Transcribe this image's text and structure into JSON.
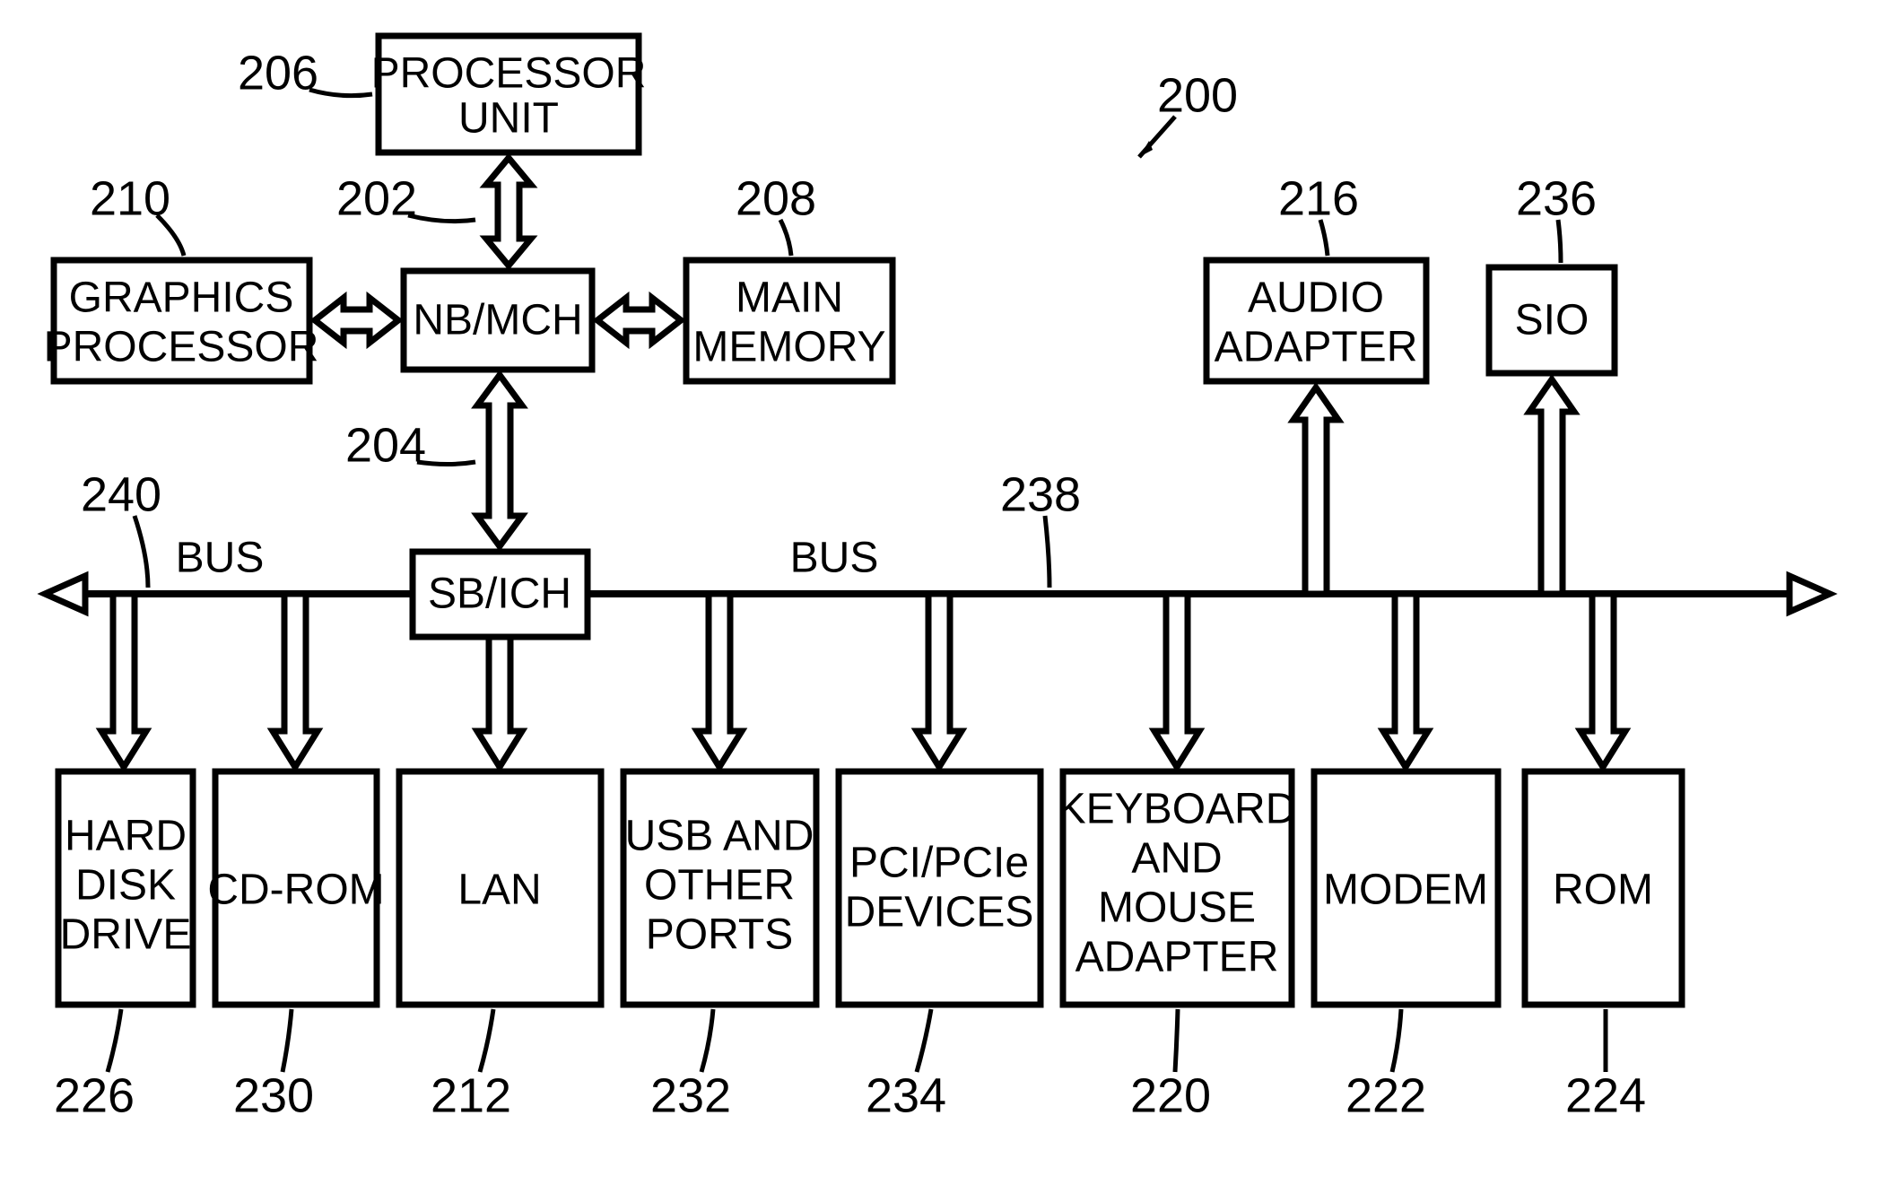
{
  "title_ref": "200",
  "bus_left": {
    "label": "BUS",
    "ref": "240"
  },
  "bus_right": {
    "label": "BUS",
    "ref": "238"
  },
  "boxes": {
    "processor": {
      "label_lines": [
        "PROCESSOR",
        "UNIT"
      ],
      "ref": "206"
    },
    "nbmch": {
      "label_lines": [
        "NB/MCH"
      ],
      "ref": "202"
    },
    "graphics": {
      "label_lines": [
        "GRAPHICS",
        "PROCESSOR"
      ],
      "ref": "210"
    },
    "mainmem": {
      "label_lines": [
        "MAIN",
        "MEMORY"
      ],
      "ref": "208"
    },
    "sbich": {
      "label_lines": [
        "SB/ICH"
      ],
      "ref": "204"
    },
    "audio": {
      "label_lines": [
        "AUDIO",
        "ADAPTER"
      ],
      "ref": "216"
    },
    "sio": {
      "label_lines": [
        "SIO"
      ],
      "ref": "236"
    },
    "hdd": {
      "label_lines": [
        "HARD",
        "DISK",
        "DRIVE"
      ],
      "ref": "226"
    },
    "cdrom": {
      "label_lines": [
        "CD-ROM"
      ],
      "ref": "230"
    },
    "lan": {
      "label_lines": [
        "LAN"
      ],
      "ref": "212"
    },
    "usb": {
      "label_lines": [
        "USB AND",
        "OTHER",
        "PORTS"
      ],
      "ref": "232"
    },
    "pci": {
      "label_lines": [
        "PCI/PCIe",
        "DEVICES"
      ],
      "ref": "234"
    },
    "kbm": {
      "label_lines": [
        "KEYBOARD",
        "AND",
        "MOUSE",
        "ADAPTER"
      ],
      "ref": "220"
    },
    "modem": {
      "label_lines": [
        "MODEM"
      ],
      "ref": "222"
    },
    "rom": {
      "label_lines": [
        "ROM"
      ],
      "ref": "224"
    }
  }
}
